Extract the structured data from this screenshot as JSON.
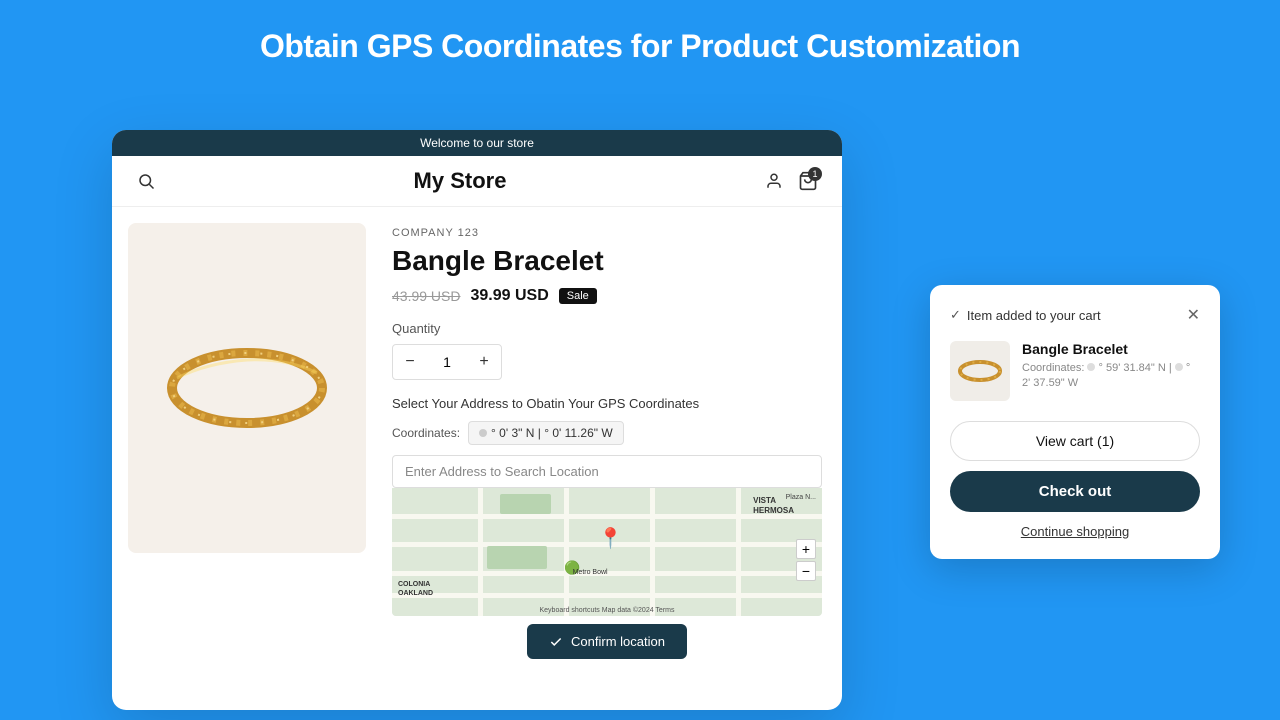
{
  "page": {
    "title": "Obtain GPS Coordinates for Product Customization",
    "background_color": "#2196F3"
  },
  "store": {
    "topbar_text": "Welcome to our store",
    "name": "My Store",
    "company_label": "COMPANY 123",
    "product_name": "Bangle Bracelet",
    "price_original": "43.99 USD",
    "price_sale": "39.99 USD",
    "sale_badge": "Sale",
    "quantity_label": "Quantity",
    "quantity_value": "1",
    "gps_section_label": "Select Your Address to Obatin Your GPS Coordinates",
    "coordinates_label": "Coordinates:",
    "coord_value": "° 0' 3\" N | ° 0' 11.26\" W",
    "address_placeholder": "Enter Address to Search Location",
    "map_label_tr": "Plaza N...",
    "map_label_vista": "VISTA\nHERMOSA",
    "map_label_colonia": "COLONIA\nOAKLAND",
    "map_zoom_plus": "+",
    "map_zoom_minus": "−",
    "map_credit": "Keyboard shortcuts  Map data ©2024  Terms",
    "confirm_btn_label": "Confirm location"
  },
  "cart_popup": {
    "added_text": "Item added to your cart",
    "item_name": "Bangle Bracelet",
    "item_coords_prefix": "Coordinates:",
    "item_coords_n": "° 59' 31.84\" N |",
    "item_coords_w": "° 2' 37.59\" W",
    "view_cart_label": "View cart (1)",
    "checkout_label": "Check out",
    "continue_label": "Continue shopping"
  },
  "icons": {
    "search": "🔍",
    "user": "👤",
    "cart": "🛒",
    "cart_count": "1",
    "minus": "−",
    "plus": "+",
    "close": "✕",
    "check": "✓",
    "pin": "📍",
    "location_check": "✓"
  }
}
